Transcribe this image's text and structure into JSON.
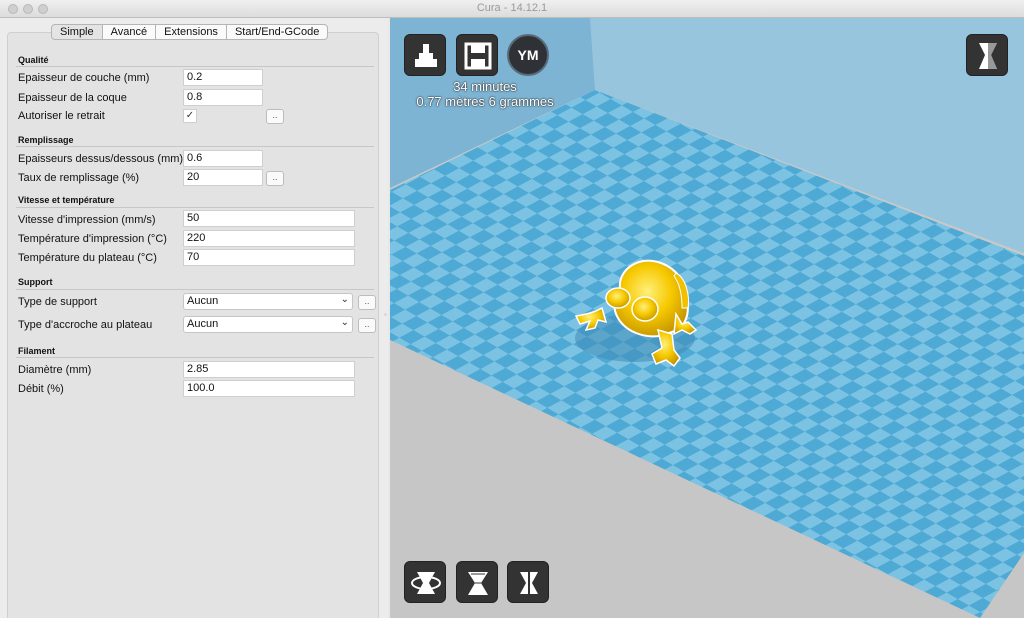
{
  "window": {
    "title": "Cura - 14.12.1"
  },
  "tabs": [
    "Simple",
    "Avancé",
    "Extensions",
    "Start/End-GCode"
  ],
  "sections": {
    "quality": "Qualité",
    "fill": "Remplissage",
    "speed": "Vitesse et température",
    "support": "Support",
    "filament": "Filament"
  },
  "fields": {
    "layer_height": {
      "label": "Epaisseur de couche (mm)",
      "value": "0.2"
    },
    "shell_thickness": {
      "label": "Epaisseur de la coque",
      "value": "0.8"
    },
    "retraction": {
      "label": "Autoriser le retrait",
      "checked": "✓"
    },
    "top_bottom": {
      "label": "Epaisseurs dessus/dessous (mm)",
      "value": "0.6"
    },
    "fill_density": {
      "label": "Taux de remplissage (%)",
      "value": "20"
    },
    "print_speed": {
      "label": "Vitesse d'impression (mm/s)",
      "value": "50"
    },
    "print_temp": {
      "label": "Température d'impression (°C)",
      "value": "220"
    },
    "bed_temp": {
      "label": "Température du plateau (°C)",
      "value": "70"
    },
    "support_type": {
      "label": "Type de support",
      "value": "Aucun"
    },
    "platform_adhesion": {
      "label": "Type d'accroche au plateau",
      "value": "Aucun"
    },
    "diameter": {
      "label": "Diamètre (mm)",
      "value": "2.85"
    },
    "flow": {
      "label": "Débit (%)",
      "value": "100.0"
    }
  },
  "ellipsis": "..",
  "print_stats": {
    "time": "34 minutes",
    "material": "0.77 mètres 6 grammes"
  },
  "toolbar": {
    "ym_label": "YM"
  },
  "colors": {
    "bed_dark": "#4ea9d5",
    "bed_light": "#7cc2e2",
    "model": "#f6c800",
    "background": "#c8c8c8"
  },
  "icons": [
    "load-icon",
    "save-icon",
    "youmagine-icon",
    "view-mode-icon",
    "rotate-icon",
    "scale-icon",
    "mirror-icon"
  ]
}
